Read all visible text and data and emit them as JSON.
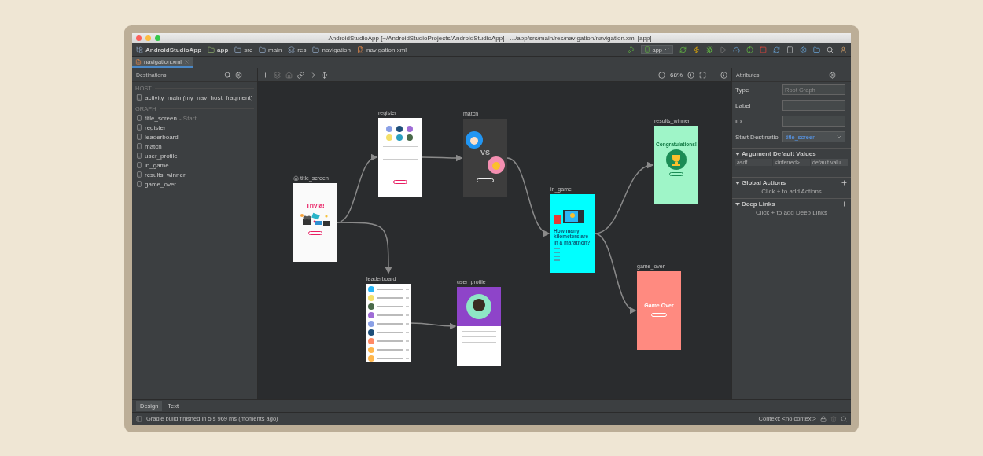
{
  "window": {
    "title": "AndroidStudioApp [~/AndroidStudioProjects/AndroidStudioApp] - .../app/src/main/res/navigation/navigation.xml [app]"
  },
  "breadcrumbs": [
    {
      "label": "AndroidStudioApp",
      "kind": "project"
    },
    {
      "label": "app",
      "kind": "module"
    },
    {
      "label": "src",
      "kind": "folder"
    },
    {
      "label": "main",
      "kind": "folder"
    },
    {
      "label": "res",
      "kind": "resfolder"
    },
    {
      "label": "navigation",
      "kind": "folder"
    },
    {
      "label": "navigation.xml",
      "kind": "file"
    }
  ],
  "run_config": {
    "label": "app"
  },
  "editor_tabs": [
    {
      "label": "navigation.xml",
      "selected": true
    }
  ],
  "destinations": {
    "title": "Destinations",
    "host": {
      "heading": "HOST",
      "items": [
        {
          "label": "activity_main (my_nav_host_fragment)"
        }
      ]
    },
    "graph": {
      "heading": "GRAPH",
      "items": [
        {
          "label": "title_screen",
          "note": "- Start"
        },
        {
          "label": "register"
        },
        {
          "label": "leaderboard"
        },
        {
          "label": "match"
        },
        {
          "label": "user_profile"
        },
        {
          "label": "in_game"
        },
        {
          "label": "results_winner"
        },
        {
          "label": "game_over"
        }
      ]
    }
  },
  "canvas": {
    "zoom": "68%",
    "nodes": [
      {
        "name": "title_screen",
        "start": true,
        "kind": "trivia",
        "text": "Trivia!"
      },
      {
        "name": "register",
        "start": false,
        "kind": "form"
      },
      {
        "name": "leaderboard",
        "start": false,
        "kind": "list"
      },
      {
        "name": "match",
        "start": false,
        "kind": "match",
        "text": "VS"
      },
      {
        "name": "user_profile",
        "start": false,
        "kind": "profile"
      },
      {
        "name": "in_game",
        "start": false,
        "kind": "quiz",
        "text": "How many kilometers are in a marathon?"
      },
      {
        "name": "results_winner",
        "start": false,
        "kind": "winner",
        "text": "Congratulations!"
      },
      {
        "name": "game_over",
        "start": false,
        "kind": "gameover",
        "text": "Game Over"
      }
    ]
  },
  "attributes": {
    "title": "Attributes",
    "fields": [
      {
        "label": "Type",
        "kind": "text",
        "placeholder": "Root Graph"
      },
      {
        "label": "Label",
        "kind": "text"
      },
      {
        "label": "ID",
        "kind": "text"
      },
      {
        "label": "Start Destinatio",
        "kind": "select",
        "value": "title_screen"
      }
    ],
    "sections": [
      {
        "title": "Argument Default Values",
        "expanded": true,
        "addable": false,
        "cells": [
          "asdf",
          "<inferred>",
          "default valu"
        ]
      },
      {
        "title": "Global Actions",
        "expanded": true,
        "addable": true,
        "hint": "Click + to add Actions"
      },
      {
        "title": "Deep Links",
        "expanded": true,
        "addable": true,
        "hint": "Click + to add Deep Links"
      }
    ]
  },
  "bottom_tabs": [
    {
      "label": "Design",
      "selected": true
    },
    {
      "label": "Text",
      "selected": false
    }
  ],
  "status": {
    "message": "Gradle build finished in 5 s 969 ms (moments ago)",
    "context": "Context: <no context>"
  }
}
